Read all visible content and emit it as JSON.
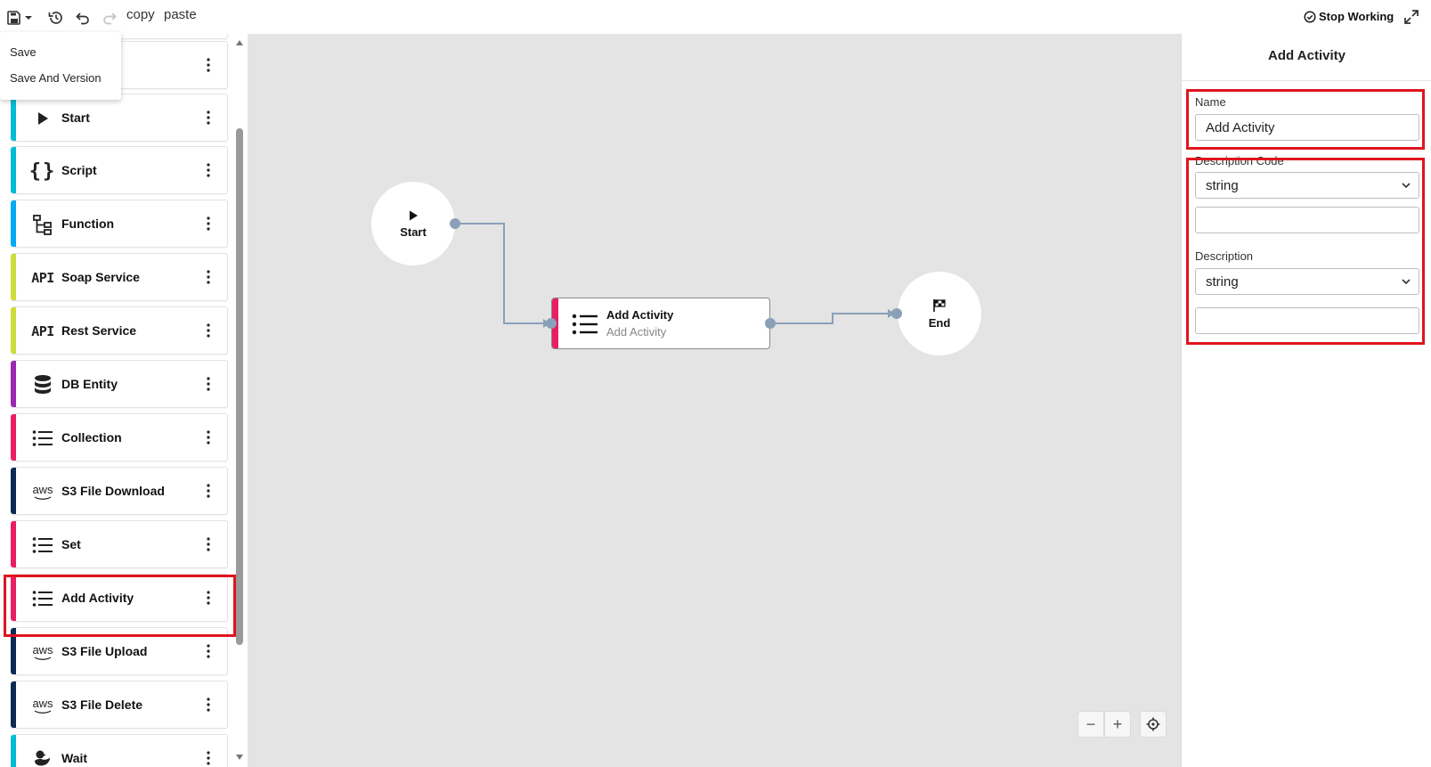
{
  "toolbar": {
    "copy_label": "copy",
    "paste_label": "paste",
    "stop_working_label": "Stop Working"
  },
  "save_menu": {
    "items": [
      "Save",
      "Save And Version"
    ]
  },
  "sidebar": {
    "items": [
      {
        "label": "",
        "icon": "blank",
        "accent": "#00bcd4"
      },
      {
        "label": "Start",
        "icon": "play-icon",
        "accent": "#00bcd4"
      },
      {
        "label": "Script",
        "icon": "braces-icon",
        "accent": "#00bcd4"
      },
      {
        "label": "Function",
        "icon": "function-tree-icon",
        "accent": "#03a9f4"
      },
      {
        "label": "Soap Service",
        "icon": "api-icon",
        "accent": "#cddc39"
      },
      {
        "label": "Rest Service",
        "icon": "api-icon",
        "accent": "#cddc39"
      },
      {
        "label": "DB Entity",
        "icon": "database-icon",
        "accent": "#9c27b0"
      },
      {
        "label": "Collection",
        "icon": "list-icon",
        "accent": "#e91e63"
      },
      {
        "label": "S3 File Download",
        "icon": "aws-icon",
        "accent": "#0d2a52"
      },
      {
        "label": "Set",
        "icon": "list-icon",
        "accent": "#e91e63"
      },
      {
        "label": "Add Activity",
        "icon": "list-icon",
        "accent": "#e91e63"
      },
      {
        "label": "S3 File Upload",
        "icon": "aws-icon",
        "accent": "#0d2a52"
      },
      {
        "label": "S3 File Delete",
        "icon": "aws-icon",
        "accent": "#0d2a52"
      },
      {
        "label": "Wait",
        "icon": "duck-icon",
        "accent": "#00bcd4"
      }
    ],
    "aws_text": "aws",
    "api_text": "API"
  },
  "canvas": {
    "start_node": {
      "label": "Start"
    },
    "activity_node": {
      "title": "Add Activity",
      "subtitle": "Add Activity"
    },
    "end_node": {
      "label": "End"
    },
    "zoom": {
      "minus": "−",
      "plus": "+"
    }
  },
  "panel": {
    "title": "Add Activity",
    "name_label": "Name",
    "name_value": "Add Activity",
    "description_code_label": "Description Code",
    "description_code_type": "string",
    "description_code_value": "",
    "description_label": "Description",
    "description_type": "string",
    "description_value": ""
  },
  "colors": {
    "highlight": "#e0141e",
    "activity_accent": "#e91e63",
    "edge": "#8aa0b8"
  }
}
